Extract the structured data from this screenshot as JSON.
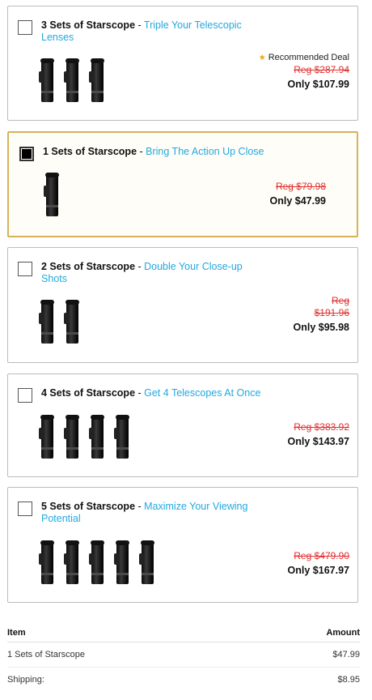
{
  "offers": [
    {
      "qty": "3 Sets of Starscope",
      "dash": " - ",
      "tag": "Triple Your Telescopic Lenses",
      "recommended": "Recommended Deal",
      "reg": "Reg $287.94",
      "only": "Only $107.99",
      "scope_count": 3,
      "selected": false
    },
    {
      "qty": "1 Sets of Starscope",
      "dash": " - ",
      "tag": "Bring The Action Up Close",
      "reg": "Reg $79.98",
      "only": "Only $47.99",
      "scope_count": 1,
      "selected": true
    },
    {
      "qty": "2 Sets of Starscope",
      "dash": " - ",
      "tag": "Double Your Close-up Shots",
      "reg_label": "Reg",
      "reg_value": "$191.96",
      "only": "Only $95.98",
      "scope_count": 2,
      "selected": false
    },
    {
      "qty": "4 Sets of Starscope",
      "dash": " - ",
      "tag": "Get 4 Telescopes At Once",
      "reg": "Reg $383.92",
      "only": "Only $143.97",
      "scope_count": 4,
      "selected": false
    },
    {
      "qty": "5 Sets of Starscope",
      "dash": " - ",
      "tag": "Maximize Your Viewing Potential",
      "reg": "Reg $479.90",
      "only": "Only $167.97",
      "scope_count": 5,
      "selected": false
    }
  ],
  "summary": {
    "header_item": "Item",
    "header_amount": "Amount",
    "rows": [
      {
        "label": "1 Sets of Starscope",
        "amount": "$47.99"
      },
      {
        "label": "Shipping:",
        "amount": "$8.95"
      }
    ]
  },
  "colors": {
    "accent": "#22a8df",
    "reg_price": "#e03030",
    "selected_border": "#d6b35a",
    "star": "#f2a51a"
  }
}
